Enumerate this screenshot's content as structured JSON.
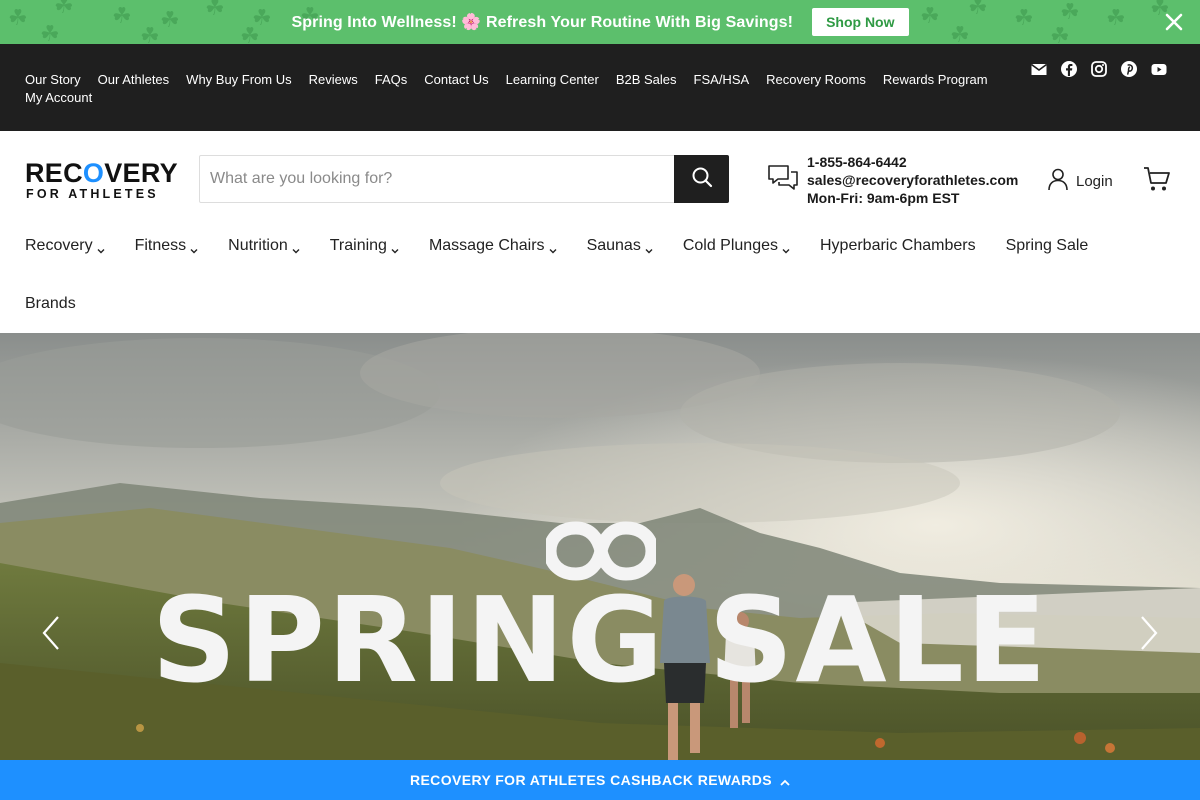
{
  "announcement": {
    "message": "Spring Into Wellness! 🌸 Refresh Your Routine With Big Savings!",
    "cta": "Shop Now",
    "bg_color": "#5cbf6c",
    "pattern_icon": "shamrock-icon",
    "close_icon": "close-icon"
  },
  "utility_nav": {
    "links": [
      "Our Story",
      "Our Athletes",
      "Why Buy From Us",
      "Reviews",
      "FAQs",
      "Contact Us",
      "Learning Center",
      "B2B Sales",
      "FSA/HSA",
      "Recovery Rooms",
      "Rewards Program",
      "My Account"
    ],
    "social_icons": [
      "email-icon",
      "facebook-icon",
      "instagram-icon",
      "pinterest-icon",
      "youtube-icon"
    ]
  },
  "header": {
    "logo_line1_a": "REC",
    "logo_line1_b": "O",
    "logo_line1_c": "VERY",
    "logo_line2": "FOR ATHLETES",
    "search_placeholder": "What are you looking for?",
    "phone": "1-855-864-6442",
    "email": "sales@recoveryforathletes.com",
    "hours": "Mon-Fri: 9am-6pm EST",
    "login_label": "Login",
    "accent_color": "#1e90ff"
  },
  "main_nav": {
    "row1": [
      {
        "label": "Recovery",
        "dropdown": true
      },
      {
        "label": "Fitness",
        "dropdown": true
      },
      {
        "label": "Nutrition",
        "dropdown": true
      },
      {
        "label": "Training",
        "dropdown": true
      },
      {
        "label": "Massage Chairs",
        "dropdown": true
      },
      {
        "label": "Saunas",
        "dropdown": true
      },
      {
        "label": "Cold Plunges",
        "dropdown": true
      },
      {
        "label": "Hyperbaric Chambers",
        "dropdown": false
      },
      {
        "label": "Spring Sale",
        "dropdown": false
      }
    ],
    "row2": [
      {
        "label": "Brands",
        "dropdown": false
      }
    ]
  },
  "hero": {
    "headline": "SPRING SALE",
    "prev_icon": "chevron-left-icon",
    "next_icon": "chevron-right-icon",
    "logo_icon": "infinity-icon"
  },
  "rewards_bar": {
    "label": "RECOVERY FOR ATHLETES CASHBACK REWARDS",
    "icon": "chevron-up-icon",
    "bg_color": "#1e90ff"
  }
}
